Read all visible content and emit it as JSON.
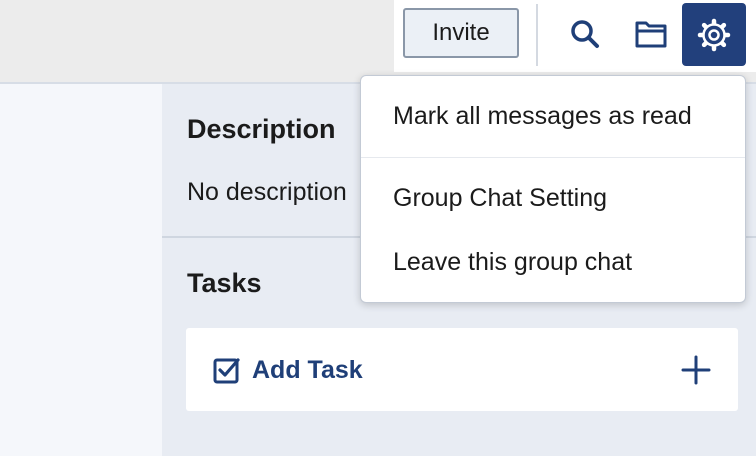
{
  "toolbar": {
    "invite_label": "Invite",
    "icons": [
      "search-icon",
      "folder-icon",
      "gear-icon"
    ],
    "accent_color": "#22407c"
  },
  "settings_menu": {
    "items": [
      {
        "label": "Mark all messages as read"
      },
      {
        "label": "Group Chat Setting"
      },
      {
        "label": "Leave this group chat"
      }
    ]
  },
  "description": {
    "title": "Description",
    "text": "No description"
  },
  "tasks": {
    "title": "Tasks",
    "add_label": "Add Task"
  }
}
